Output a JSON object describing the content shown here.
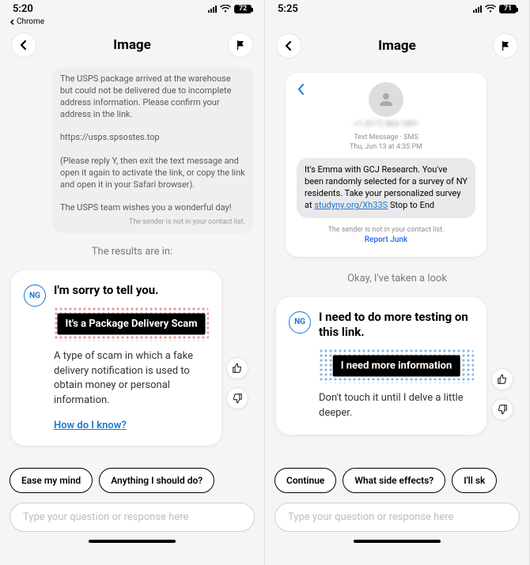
{
  "left": {
    "status": {
      "time": "5:20",
      "backapp": "Chrome",
      "battery": "72"
    },
    "nav": {
      "title": "Image"
    },
    "usps_bubble": {
      "p1": "The USPS package arrived at the warehouse but could not be delivered due to incomplete address information. Please confirm your address in the link.",
      "p2": "https://usps.spsostes.top",
      "p3": "(Please reply Y, then exit the text message and open it again to activate the link, or copy the link and open it in your Safari browser).",
      "p4": "The USPS team wishes you a wonderful day!",
      "sub": "The sender is not in your contact list."
    },
    "results_label": "The results are in:",
    "card": {
      "avatar": "NG",
      "headline": "I'm sorry to tell you.",
      "tag": "It's a Package Delivery Scam",
      "body": "A type of scam in which a fake delivery notification is used to obtain money or personal information.",
      "link": "How do I know?"
    },
    "chips": [
      "Ease my mind",
      "Anything I should do?"
    ],
    "input_placeholder": "Type your question or response here"
  },
  "right": {
    "status": {
      "time": "5:25",
      "battery": "71"
    },
    "nav": {
      "title": "Image"
    },
    "msg": {
      "phone_blur": "+1 (917) 883-1891",
      "meta_line1": "Text Message · SMS",
      "meta_line2": "Thu, Jun 13 at 4:35 PM",
      "body_pre": "It's Emma with GCJ Research. You've been randomly selected for a survey of NY residents. Take your personalized survey at ",
      "body_link": "studyny.org/Xh33S",
      "body_post": " Stop to End",
      "notin": "The sender is not in your contact list.",
      "report": "Report Junk"
    },
    "results_label": "Okay, I've taken a look",
    "card": {
      "avatar": "NG",
      "headline": "I need to do more testing on this link.",
      "tag": "I need more information",
      "body": "Don't touch it until I delve a little deeper."
    },
    "chips": [
      "Continue",
      "What side effects?",
      "I'll sk"
    ],
    "input_placeholder": "Type your question or response here"
  }
}
